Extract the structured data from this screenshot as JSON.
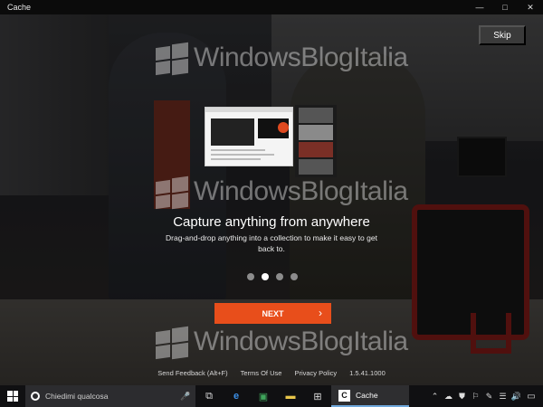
{
  "window": {
    "title": "Cache",
    "controls": {
      "minimize": "—",
      "maximize": "□",
      "close": "✕"
    }
  },
  "watermark": {
    "text": "WindowsBlogItalia"
  },
  "onboarding": {
    "skip_label": "Skip",
    "headline": "Capture anything from anywhere",
    "description": "Drag-and-drop anything into a collection to make it easy to get back to.",
    "pages_total": 4,
    "current_page": 2,
    "next_label": "NEXT",
    "next_arrow": "›"
  },
  "footer": {
    "feedback": "Send Feedback (Alt+F)",
    "terms": "Terms Of Use",
    "privacy": "Privacy Policy",
    "version": "1.5.41.1000"
  },
  "taskbar": {
    "search_placeholder": "Chiedimi qualcosa",
    "mic_icon": "🎤",
    "pinned": [
      {
        "name": "task-view-icon",
        "glyph": "⧉"
      },
      {
        "name": "edge-icon",
        "glyph": "e"
      },
      {
        "name": "store-icon",
        "glyph": "▣"
      },
      {
        "name": "file-explorer-icon",
        "glyph": "▬"
      },
      {
        "name": "windows-store-icon",
        "glyph": "⊞"
      }
    ],
    "running_app": {
      "icon_letter": "C",
      "label": "Cache"
    },
    "tray": [
      "⌃",
      "☁",
      "⛊",
      "⚐",
      "✎",
      "☰",
      "🔊"
    ],
    "notification_icon": "▭"
  },
  "colors": {
    "accent": "#e84e1b",
    "taskbar": "#101012",
    "titlebar": "#0b0b0b",
    "dot_active": "#ffffff",
    "dot_inactive": "#8c8c8c"
  }
}
